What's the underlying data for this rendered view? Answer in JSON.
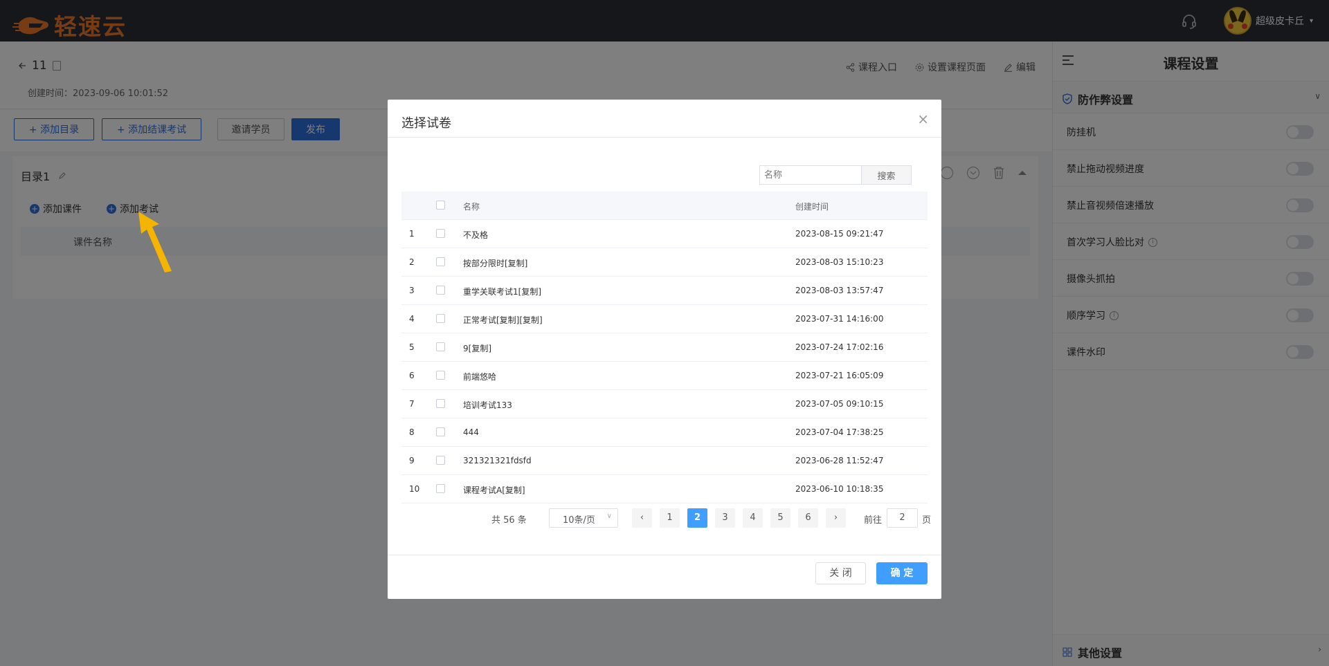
{
  "header": {
    "logo_text": "轻速云",
    "user_name": "超级皮卡丘",
    "user_caret": "▾"
  },
  "course": {
    "title": "11",
    "created_label": "创建时间：2023-09-06 10:01:52",
    "actions": [
      "课程入口",
      "设置课程页面",
      "编辑"
    ]
  },
  "toolbar": {
    "add_catalog": "+ 添加目录",
    "add_final_exam": "+ 添加结课考试",
    "invite_students": "邀请学员",
    "publish": "发布"
  },
  "section": {
    "title": "目录1",
    "add_courseware": "添加课件",
    "add_exam": "添加考试",
    "col_header": "课件名称"
  },
  "right_panel": {
    "title": "课程设置",
    "group_title": "防作弊设置",
    "items": [
      {
        "label": "防挂机",
        "info": false
      },
      {
        "label": "禁止拖动视频进度",
        "info": false
      },
      {
        "label": "禁止音视频倍速播放",
        "info": false
      },
      {
        "label": "首次学习人脸比对",
        "info": true
      },
      {
        "label": "摄像头抓拍",
        "info": false
      },
      {
        "label": "顺序学习",
        "info": true
      },
      {
        "label": "课件水印",
        "info": false
      }
    ],
    "bottom_group": "其他设置"
  },
  "modal": {
    "title": "选择试卷",
    "close_glyph": "×",
    "search_placeholder": "名称",
    "search_button": "搜索",
    "columns": {
      "name": "名称",
      "created": "创建时间"
    },
    "rows": [
      {
        "idx": "1",
        "name": "不及格",
        "time": "2023-08-15 09:21:47"
      },
      {
        "idx": "2",
        "name": "按部分限时[复制]",
        "time": "2023-08-03 15:10:23"
      },
      {
        "idx": "3",
        "name": "重学关联考试1[复制]",
        "time": "2023-08-03 13:57:47"
      },
      {
        "idx": "4",
        "name": "正常考试[复制][复制]",
        "time": "2023-07-31 14:16:00"
      },
      {
        "idx": "5",
        "name": "9[复制]",
        "time": "2023-07-24 17:02:16"
      },
      {
        "idx": "6",
        "name": "前端悠哈",
        "time": "2023-07-21 16:05:09"
      },
      {
        "idx": "7",
        "name": "培训考试133",
        "time": "2023-07-05 09:10:15"
      },
      {
        "idx": "8",
        "name": "444",
        "time": "2023-07-04 17:38:25"
      },
      {
        "idx": "9",
        "name": "321321321fdsfd",
        "time": "2023-06-28 11:52:47"
      },
      {
        "idx": "10",
        "name": "课程考试A[复制]",
        "time": "2023-06-10 10:18:35"
      }
    ],
    "pager": {
      "total": "共 56 条",
      "page_size": "10条/页",
      "prev": "‹",
      "next": "›",
      "pages": [
        "1",
        "2",
        "3",
        "4",
        "5",
        "6"
      ],
      "current": "2",
      "goto_label": "前往",
      "goto_value": "2",
      "page_suffix": "页"
    },
    "close_button": "关 闭",
    "ok_button": "确 定"
  }
}
